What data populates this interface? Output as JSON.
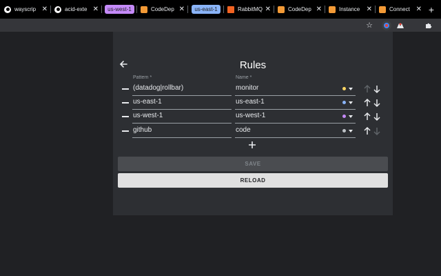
{
  "browser": {
    "tabs": [
      {
        "icon": "github-icon",
        "title": "wayscrip",
        "pill": null
      },
      {
        "icon": "github-icon",
        "title": "acid-exte",
        "pill": null
      },
      {
        "icon": null,
        "title": "",
        "pill": "us-west-1",
        "pill_color": "#c58af9"
      },
      {
        "icon": "aws-box-icon",
        "title": "CodeDep",
        "pill": null
      },
      {
        "icon": null,
        "title": "",
        "pill": "us-east-1",
        "pill_color": "#8ab4f8"
      },
      {
        "icon": "rabbitmq-icon",
        "title": "RabbitMQ",
        "pill": null
      },
      {
        "icon": "aws-box-icon",
        "title": "CodeDep",
        "pill": null
      },
      {
        "icon": "aws-box-icon",
        "title": "Instance",
        "pill": null
      },
      {
        "icon": "aws-box-icon",
        "title": "Connect",
        "pill": null
      }
    ],
    "new_tab": "+"
  },
  "popup": {
    "title": "Rules",
    "pattern_label": "Pattern *",
    "name_label": "Name *",
    "rules": [
      {
        "pattern": "(datadog|rollbar)",
        "name": "monitor",
        "color": "#fdd663",
        "up_enabled": false,
        "down_enabled": true
      },
      {
        "pattern": "us-east-1",
        "name": "us-east-1",
        "color": "#8ab4f8",
        "up_enabled": true,
        "down_enabled": true
      },
      {
        "pattern": "us-west-1",
        "name": "us-west-1",
        "color": "#c58af9",
        "up_enabled": true,
        "down_enabled": true
      },
      {
        "pattern": "github",
        "name": "code",
        "color": "#bdc1c6",
        "up_enabled": true,
        "down_enabled": false
      }
    ],
    "save_label": "SAVE",
    "reload_label": "RELOAD"
  }
}
